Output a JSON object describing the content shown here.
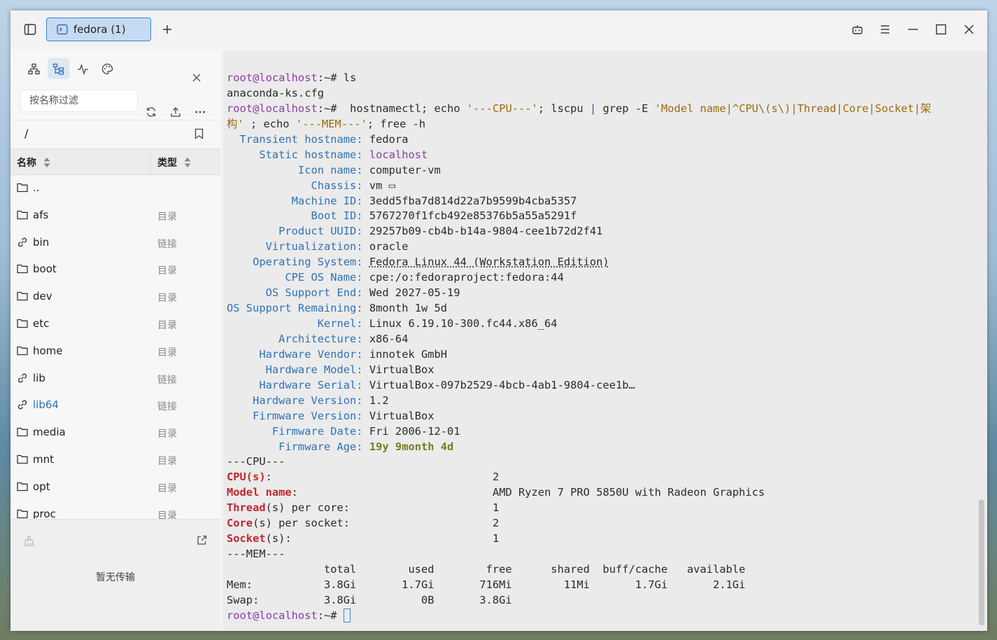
{
  "titlebar": {
    "tab_label": "fedora (1)"
  },
  "sidebar": {
    "filter_placeholder": "按名称过滤",
    "path": "/",
    "col_name": "名称",
    "col_type": "类型",
    "files": [
      {
        "name": "..",
        "type": "",
        "icon": "folder-icon"
      },
      {
        "name": "afs",
        "type": "目录",
        "icon": "folder-icon"
      },
      {
        "name": "bin",
        "type": "链接",
        "icon": "link-icon"
      },
      {
        "name": "boot",
        "type": "目录",
        "icon": "folder-icon"
      },
      {
        "name": "dev",
        "type": "目录",
        "icon": "folder-icon"
      },
      {
        "name": "etc",
        "type": "目录",
        "icon": "folder-icon"
      },
      {
        "name": "home",
        "type": "目录",
        "icon": "folder-icon"
      },
      {
        "name": "lib",
        "type": "链接",
        "icon": "link-icon"
      },
      {
        "name": "lib64",
        "type": "链接",
        "icon": "link-icon"
      },
      {
        "name": "media",
        "type": "目录",
        "icon": "folder-icon"
      },
      {
        "name": "mnt",
        "type": "目录",
        "icon": "folder-icon"
      },
      {
        "name": "opt",
        "type": "目录",
        "icon": "folder-icon"
      },
      {
        "name": "proc",
        "type": "目录",
        "icon": "folder-icon"
      }
    ],
    "transfer_empty": "暂无传输"
  },
  "terminal": {
    "prompt": "root@localhost",
    "prompt_suffix": ":~#",
    "cmd1": " ls",
    "out1": "anaconda-ks.cfg",
    "cmd2_a": "  hostnamectl; echo ",
    "cmd2_str1": "'---CPU---'",
    "cmd2_b": "; lscpu ",
    "cmd2_pipe": "|",
    "cmd2_c": " grep -E ",
    "cmd2_str2a": "'Model name|^CPU\\(s\\)|Thread|Core|Socket|架",
    "cmd2_str2b": "构'",
    "cmd2_d": " ; echo ",
    "cmd2_str3": "'---MEM---'",
    "cmd2_e": "; free -h",
    "hostinfo": [
      {
        "key": "  Transient hostname: ",
        "val": "fedora",
        "style": ""
      },
      {
        "key": "     Static hostname: ",
        "val": "localhost",
        "style": "mg"
      },
      {
        "key": "           Icon name: ",
        "val": "computer-vm",
        "style": ""
      },
      {
        "key": "             Chassis: ",
        "val": "vm ▭",
        "style": ""
      },
      {
        "key": "          Machine ID: ",
        "val": "3edd5fba7d814d22a7b9599b4cba5357",
        "style": ""
      },
      {
        "key": "             Boot ID: ",
        "val": "5767270f1fcb492e85376b5a55a5291f",
        "style": ""
      },
      {
        "key": "        Product UUID: ",
        "val": "29257b09-cb4b-b14a-9804-cee1b72d2f41",
        "style": ""
      },
      {
        "key": "      Virtualization: ",
        "val": "oracle",
        "style": ""
      },
      {
        "key": "    Operating System: ",
        "val": "Fedora Linux 44 (Workstation Edition)",
        "style": "ul"
      },
      {
        "key": "         CPE OS Name: ",
        "val": "cpe:/o:fedoraproject:fedora:44",
        "style": ""
      },
      {
        "key": "      OS Support End: ",
        "val": "Wed 2027-05-19",
        "style": ""
      },
      {
        "key": "OS Support Remaining: ",
        "val": "8month 1w 5d",
        "style": ""
      },
      {
        "key": "              Kernel: ",
        "val": "Linux 6.19.10-300.fc44.x86_64",
        "style": ""
      },
      {
        "key": "        Architecture: ",
        "val": "x86-64",
        "style": ""
      },
      {
        "key": "     Hardware Vendor: ",
        "val": "innotek GmbH",
        "style": ""
      },
      {
        "key": "      Hardware Model: ",
        "val": "VirtualBox",
        "style": ""
      },
      {
        "key": "     Hardware Serial: ",
        "val": "VirtualBox-097b2529-4bcb-4ab1-9804-cee1b…",
        "style": ""
      },
      {
        "key": "    Hardware Version: ",
        "val": "1.2",
        "style": ""
      },
      {
        "key": "    Firmware Version: ",
        "val": "VirtualBox",
        "style": ""
      },
      {
        "key": "       Firmware Date: ",
        "val": "Fri 2006-12-01",
        "style": ""
      },
      {
        "key": "        Firmware Age: ",
        "val": "19y 9month 4d",
        "style": "yl"
      }
    ],
    "cpu_header": "---CPU---",
    "cpu": [
      {
        "hl": "CPU(s)",
        "rest": ":",
        "val": "2"
      },
      {
        "hl": "Model name",
        "rest": ":",
        "val": "AMD Ryzen 7 PRO 5850U with Radeon Graphics"
      },
      {
        "hl": "Thread",
        "rest": "(s) per core:",
        "val": "1"
      },
      {
        "hl": "Core",
        "rest": "(s) per socket:",
        "val": "2"
      },
      {
        "hl": "Socket",
        "rest": "(s):",
        "val": "1"
      }
    ],
    "mem_header": "---MEM---",
    "mem_cols": "               total        used        free      shared  buff/cache   available",
    "mem_row": "Mem:           3.8Gi       1.7Gi       716Mi        11Mi       1.7Gi       2.1Gi",
    "swap_row": "Swap:          3.8Gi          0B       3.8Gi"
  }
}
